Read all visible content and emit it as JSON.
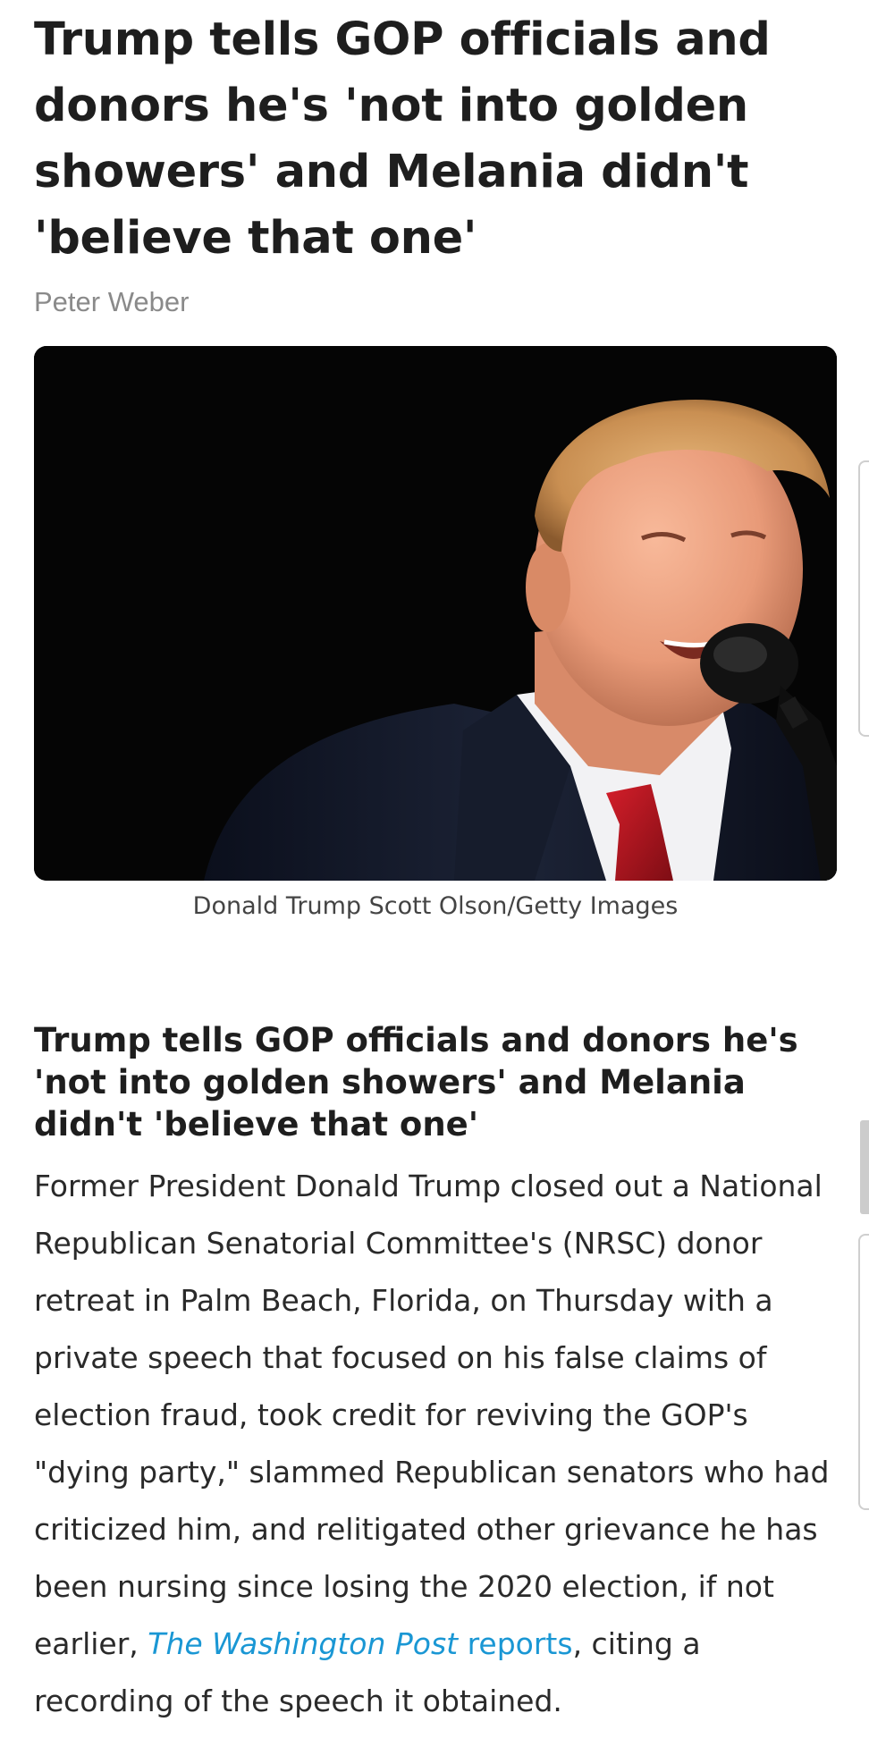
{
  "article": {
    "headline_lines": [
      "Trump tells GOP officials and",
      "donors he's 'not into golden",
      "showers' and Melania didn't",
      "'believe that one'"
    ],
    "byline": "Peter Weber",
    "image": {
      "caption": "Donald Trump Scott Olson/Getty Images"
    },
    "subheadline": "Trump tells GOP officials and donors he's 'not into golden showers' and Melania didn't 'believe that one'",
    "body_before_link": "Former President Donald Trump closed out a National Republican Senatorial Committee's (NRSC) donor retreat in Palm Beach, Florida, on Thursday with a private speech that focused on his false claims of election fraud, took credit for reviving the GOP's \"dying party,\" slammed Republican senators who had criticized him, and relitigated other griev­ance he has been nursing since losing the 2020 elec­tion, if not earlier, ",
    "link_publication": "The Washington Post",
    "link_suffix": " reports",
    "body_after_link": ", citing a recording of the speech it obtained."
  },
  "colors": {
    "link": "#1a97d4",
    "byline": "#8a8a8a",
    "image_background": "#050505"
  }
}
